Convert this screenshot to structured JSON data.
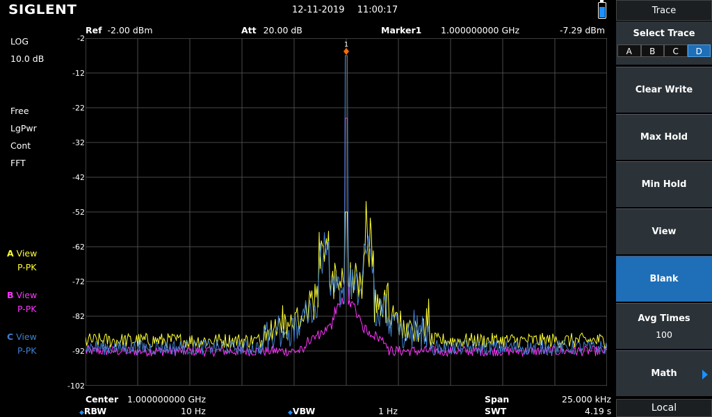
{
  "header": {
    "logo": "SIGLENT",
    "date": "12-11-2019",
    "time": "11:00:17"
  },
  "infobar": {
    "ref_label": "Ref",
    "ref_value": "-2.00 dBm",
    "att_label": "Att",
    "att_value": "20.00 dB",
    "marker_label": "Marker1",
    "marker_freq": "1.000000000 GHz",
    "marker_level": "-7.29 dBm"
  },
  "left": {
    "scale_type": "LOG",
    "scale_div": "10.0 dB",
    "trig": "Free",
    "avg_type": "LgPwr",
    "sweep": "Cont",
    "mode": "FFT"
  },
  "traces": [
    {
      "letter": "A",
      "view": "View",
      "det": "P-PK",
      "color": "#ffff33"
    },
    {
      "letter": "B",
      "view": "View",
      "det": "P-PK",
      "color": "#ff33ff"
    },
    {
      "letter": "C",
      "view": "View",
      "det": "P-PK",
      "color": "#3f7fcf"
    }
  ],
  "yticks": [
    "-2",
    "-12",
    "-22",
    "-32",
    "-42",
    "-52",
    "-62",
    "-72",
    "-82",
    "-92",
    "-102"
  ],
  "marker_number": "1",
  "bottom": {
    "center_label": "Center",
    "center_value": "1.000000000 GHz",
    "span_label": "Span",
    "span_value": "25.000 kHz",
    "rbw_label": "RBW",
    "rbw_value": "10 Hz",
    "vbw_label": "VBW",
    "vbw_value": "1 Hz",
    "swt_label": "SWT",
    "swt_value": "4.19 s"
  },
  "menu": {
    "title": "Trace",
    "select_trace": "Select Trace",
    "tabs": [
      "A",
      "B",
      "C",
      "D"
    ],
    "active_tab": "D",
    "clear_write": "Clear Write",
    "max_hold": "Max Hold",
    "min_hold": "Min Hold",
    "view": "View",
    "blank": "Blank",
    "avg_times": "Avg Times",
    "avg_times_value": "100",
    "math": "Math",
    "local": "Local"
  },
  "colors": {
    "grid": "#4a4a4a",
    "accent": "#1e6eb8",
    "trace_a": "#ffff33",
    "trace_b": "#ff33ff",
    "trace_c": "#3f7fcf",
    "marker": "#ff6a00"
  }
}
